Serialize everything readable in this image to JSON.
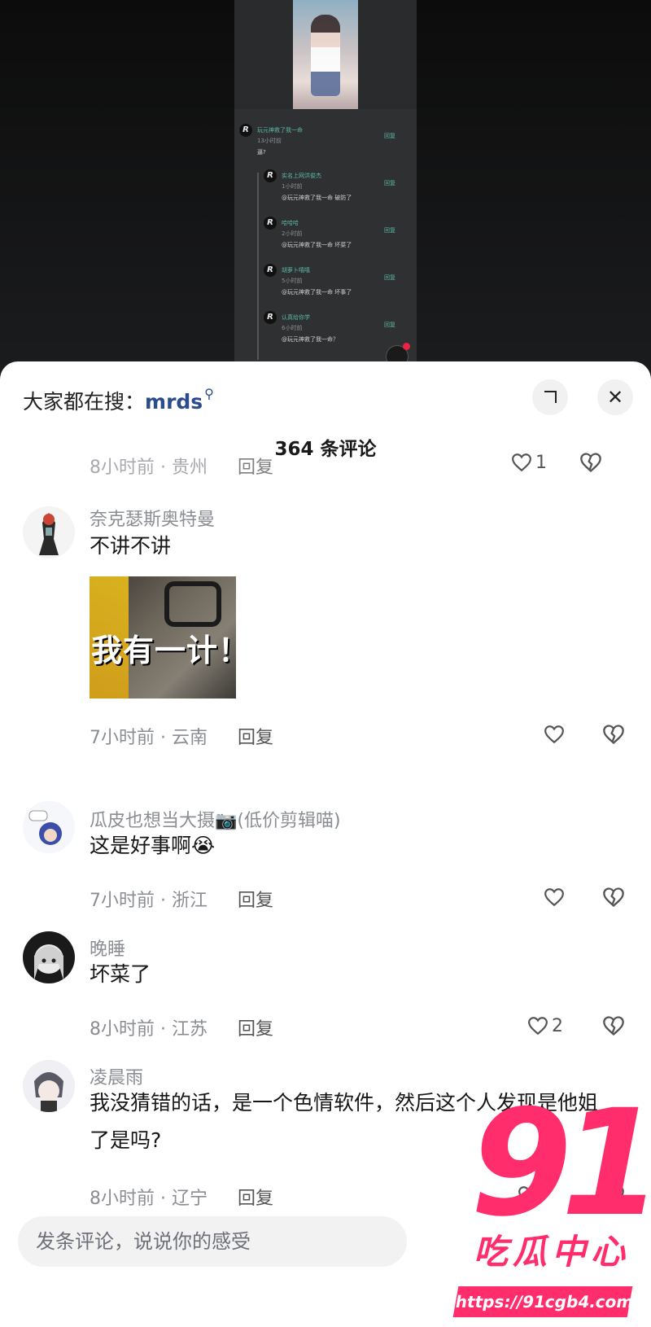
{
  "video": {
    "mini_comments": [
      {
        "name": "玩元神救了我一命",
        "time": "13小时前",
        "text": "逼?",
        "reply": "回复"
      },
      {
        "name": "实名上网洪俊杰",
        "time": "1小时前",
        "text": "@玩元神救了我一命 破防了",
        "reply": "回复"
      },
      {
        "name": "哈哈哈",
        "time": "2小时前",
        "text": "@玩元神救了我一命 坏菜了",
        "reply": "回复"
      },
      {
        "name": "胡萝卜嘻嘻",
        "time": "5小时前",
        "text": "@玩元神救了我一命 坏事了",
        "reply": "回复"
      },
      {
        "name": "认真给你学",
        "time": "6小时前",
        "text": "@玩元神救了我一命？",
        "reply": "回复"
      }
    ]
  },
  "sheet": {
    "search_prefix": "大家都在搜：",
    "search_keyword": "mrds",
    "close_symbol": "✕",
    "title": "364 条评论",
    "partial_meta": "8小时前 · 贵州",
    "partial_reply": "回复",
    "partial_likes": "1"
  },
  "comments": [
    {
      "user": "奈克瑟斯奥特曼",
      "text": "不讲不讲",
      "meme_text": "我有一计！",
      "meta": "7小时前 · 云南",
      "reply": "回复",
      "likes": ""
    },
    {
      "user": "瓜皮也想当大摄📷(低价剪辑喵)",
      "text": "这是好事啊😭",
      "meta": "7小时前 · 浙江",
      "reply": "回复",
      "likes": ""
    },
    {
      "user": "晚睡",
      "text": "坏菜了",
      "meta": "8小时前 · 江苏",
      "reply": "回复",
      "likes": "2"
    },
    {
      "user": "凌晨雨",
      "text": "我没猜错的话，是一个色情软件，然后这个人发现是他姐了是吗?",
      "meta": "8小时前 · 辽宁",
      "reply": "回复",
      "likes": ""
    }
  ],
  "input": {
    "placeholder": "发条评论，说说你的感受"
  },
  "watermark": {
    "number": "91",
    "name": "吃瓜中心",
    "url": "https://91cgb4.com"
  },
  "colors": {
    "accent": "#2b4b8c",
    "watermark": "#ff2d6b",
    "mini_name": "#5bb8a6"
  }
}
